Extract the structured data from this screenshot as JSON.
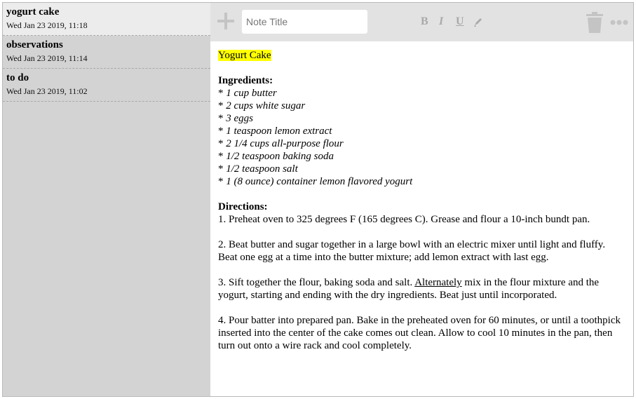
{
  "notes": [
    {
      "title": "yogurt cake",
      "date": "Wed Jan 23 2019, 11:18",
      "active": true
    },
    {
      "title": "observations",
      "date": "Wed Jan 23 2019, 11:14",
      "active": false
    },
    {
      "title": "to do",
      "date": "Wed Jan 23 2019, 11:02",
      "active": false
    }
  ],
  "toolbar": {
    "title_placeholder": "Note Title",
    "bold_label": "B",
    "italic_label": "I",
    "underline_label": "U",
    "icons": [
      "add-icon",
      "bold-icon",
      "italic-icon",
      "underline-icon",
      "highlight-icon",
      "trash-icon",
      "more-icon"
    ]
  },
  "editor": {
    "heading": "Yogurt Cake",
    "ingredients_label": "Ingredients:",
    "bullet": "* ",
    "ingredients": [
      "1 cup butter",
      "2 cups white sugar",
      "3 eggs",
      "1 teaspoon lemon extract",
      "2 1/4 cups all-purpose flour",
      "1/2 teaspoon baking soda",
      "1/2 teaspoon salt",
      "1 (8 ounce) container lemon flavored yogurt"
    ],
    "directions_label": "Directions:",
    "step1": "1. Preheat oven to 325 degrees F (165 degrees C). Grease and flour a 10-inch bundt pan.",
    "step2": "2. Beat butter and sugar together in a large bowl with an electric mixer until light and fluffy. Beat one egg at a time into the butter mixture; add lemon extract with last egg.",
    "step3_before": "3. Sift together the flour, baking soda and salt. ",
    "step3_underlined": "Alternately",
    "step3_after": " mix in the flour mixture and the yogurt, starting and ending with the dry ingredients. Beat just until incorporated.",
    "step4": "4. Pour batter into prepared pan. Bake in the preheated oven for 60 minutes, or until a toothpick inserted into the center of the cake comes out clean. Allow to cool 10 minutes in the pan, then turn out onto a wire rack and cool completely."
  },
  "colors": {
    "highlight": "#ffff00",
    "sidebar_bg": "#d3d3d3",
    "active_note_bg": "#ececec",
    "toolbar_bg": "#e2e2e2",
    "icon_gray": "#c4c4c4"
  }
}
